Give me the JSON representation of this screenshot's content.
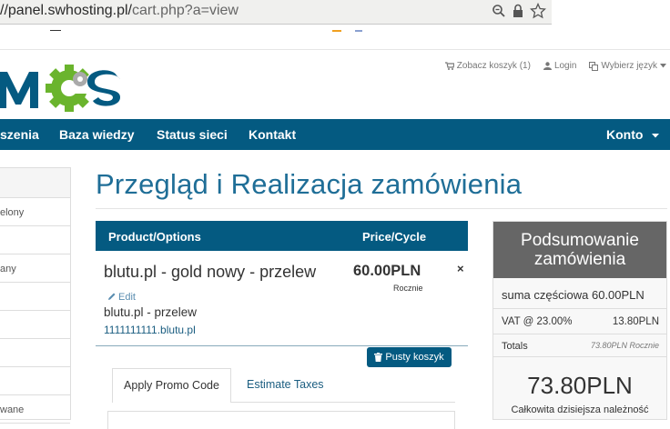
{
  "browser": {
    "url_host": "//panel.swhosting.pl/",
    "url_path": "cart.php?a=view"
  },
  "header": {
    "links": {
      "cart": "Zobacz koszyk (1)",
      "login": "Login",
      "language": "Wybierz język"
    }
  },
  "nav": {
    "items": [
      "szenia",
      "Baza wiedzy",
      "Status sieci",
      "Kontakt"
    ],
    "account": "Konto"
  },
  "sidebar": {
    "items": [
      "elony",
      "",
      "any",
      "",
      "",
      "",
      "",
      "wane"
    ]
  },
  "page": {
    "title": "Przegląd i Realizacja zamówienia"
  },
  "cart": {
    "col_product": "Product/Options",
    "col_price": "Price/Cycle",
    "item": {
      "name": "blutu.pl - gold nowy - przelew",
      "edit": "Edit",
      "subtitle": "blutu.pl - przelew",
      "domain": "1111111111.blutu.pl",
      "price": "60.00PLN",
      "cycle": "Rocznie",
      "remove": "×"
    },
    "empty_button": "Pusty koszyk"
  },
  "tabs": {
    "promo": "Apply Promo Code",
    "taxes": "Estimate Taxes"
  },
  "summary": {
    "title": "Podsumowanie zamówienia",
    "subtotal": "suma częściowa 60.00PLN",
    "vat_label": "VAT @ 23.00%",
    "vat_value": "13.80PLN",
    "totals_label": "Totals",
    "totals_value": "73.80PLN Rocznie",
    "due_today": "73.80PLN",
    "due_caption": "Całkowita dzisiejsza należność"
  },
  "colors": {
    "primary": "#045a81",
    "title": "#1f6e97",
    "logo_green": "#6ab42d",
    "summary_head": "#666666"
  }
}
